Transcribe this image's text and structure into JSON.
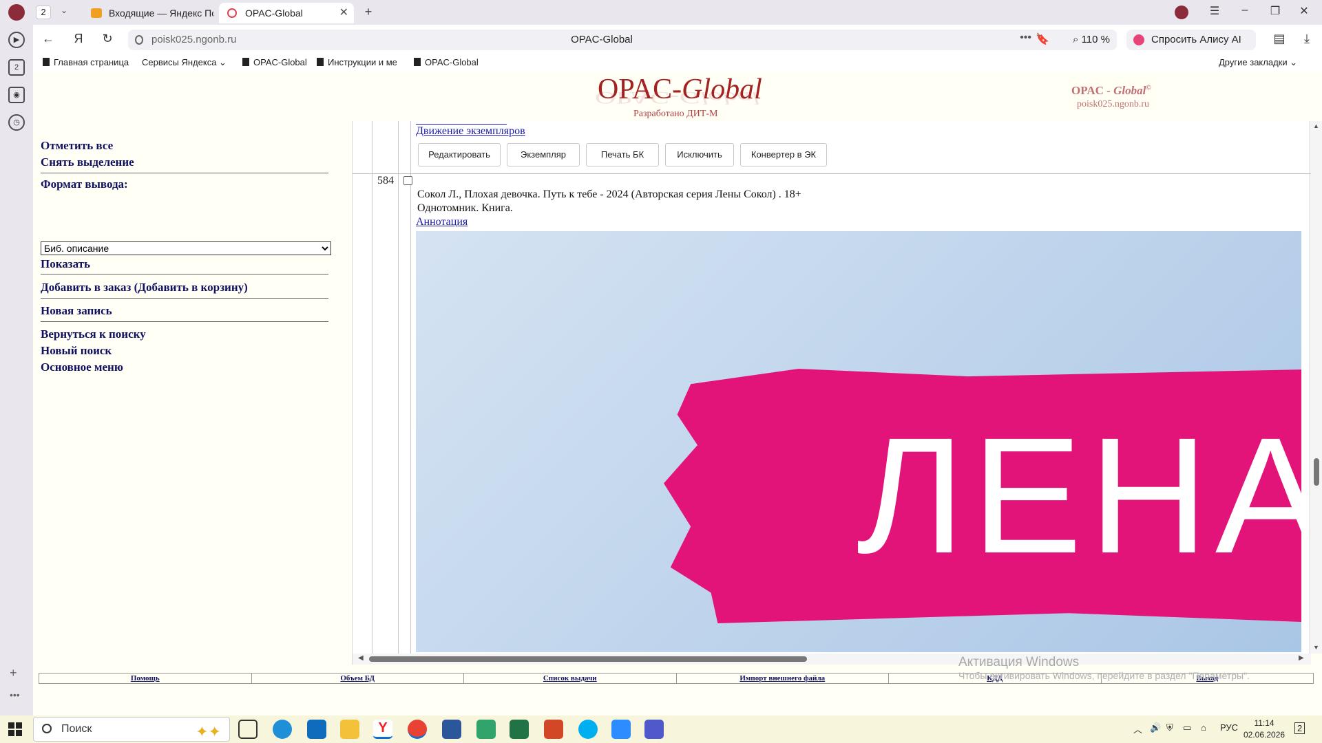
{
  "browser": {
    "tab_count": "2",
    "tabs": [
      {
        "title": "Входящие — Яндекс Почта",
        "active": false
      },
      {
        "title": "OPAC-Global",
        "active": true
      }
    ],
    "address": {
      "domain": "poisk025.ngonb.ru",
      "page_title": "OPAC-Global"
    },
    "zoom": "110 %",
    "alice_label": "Спросить Алису AI",
    "bookmarks": [
      "Главная страница",
      "Сервисы Яндекса",
      "OPAC-Global",
      "Инструкции и ме",
      "OPAC-Global"
    ],
    "other_bookmarks": "Другие закладки"
  },
  "header": {
    "logo_opac": "OPAC-",
    "logo_global": "Global",
    "developed_by": "Разработано ДИТ-М",
    "right_opac": "OPAC - ",
    "right_global": "Global",
    "right_reg": "©",
    "right_domain": "poisk025.ngonb.ru"
  },
  "left_panel": {
    "select_all": "Отметить все",
    "deselect": "Снять выделение",
    "format_label": "Формат вывода:",
    "format_value": "Биб. описание",
    "show": "Показать",
    "add_to_order": "Добавить в заказ (Добавить в корзину)",
    "new_record": "Новая запись",
    "back_to_search": "Вернуться к поиску",
    "new_search": "Новый поиск",
    "main_menu": "Основное меню"
  },
  "prev_record": {
    "movement_link": "Движение экземпляров",
    "buttons": [
      "Редактировать",
      "Экземпляр",
      "Печать БК",
      "Исключить",
      "Конвертер в ЭК"
    ]
  },
  "record": {
    "number": "584",
    "line1": "Сокол Л., Плохая девочка. Путь к тебе - 2024 (Авторская серия Лены Сокол) . 18+",
    "line2": "Однотомник. Книга.",
    "annotation_link": "Аннотация",
    "cover_text": "ЛЕНА"
  },
  "footer": {
    "links": [
      "Помощь",
      "Объем БД",
      "Список выдачи",
      "Импорт внешнего файла",
      "КДД",
      "Выход"
    ],
    "watermark_title": "Активация Windows",
    "watermark_text": "Чтобы активировать Windows, перейдите в раздел \"Параметры\"."
  },
  "taskbar": {
    "search_placeholder": "Поиск",
    "language": "РУС",
    "time": "11:14",
    "date": "02.06.2026",
    "notifications": "2"
  },
  "colors": {
    "page_bg": "#fffff6",
    "logo_red": "#a52222",
    "link_navy": "#101060",
    "cover_pink": "#e2147a",
    "cover_sky": "#aac6e6"
  }
}
